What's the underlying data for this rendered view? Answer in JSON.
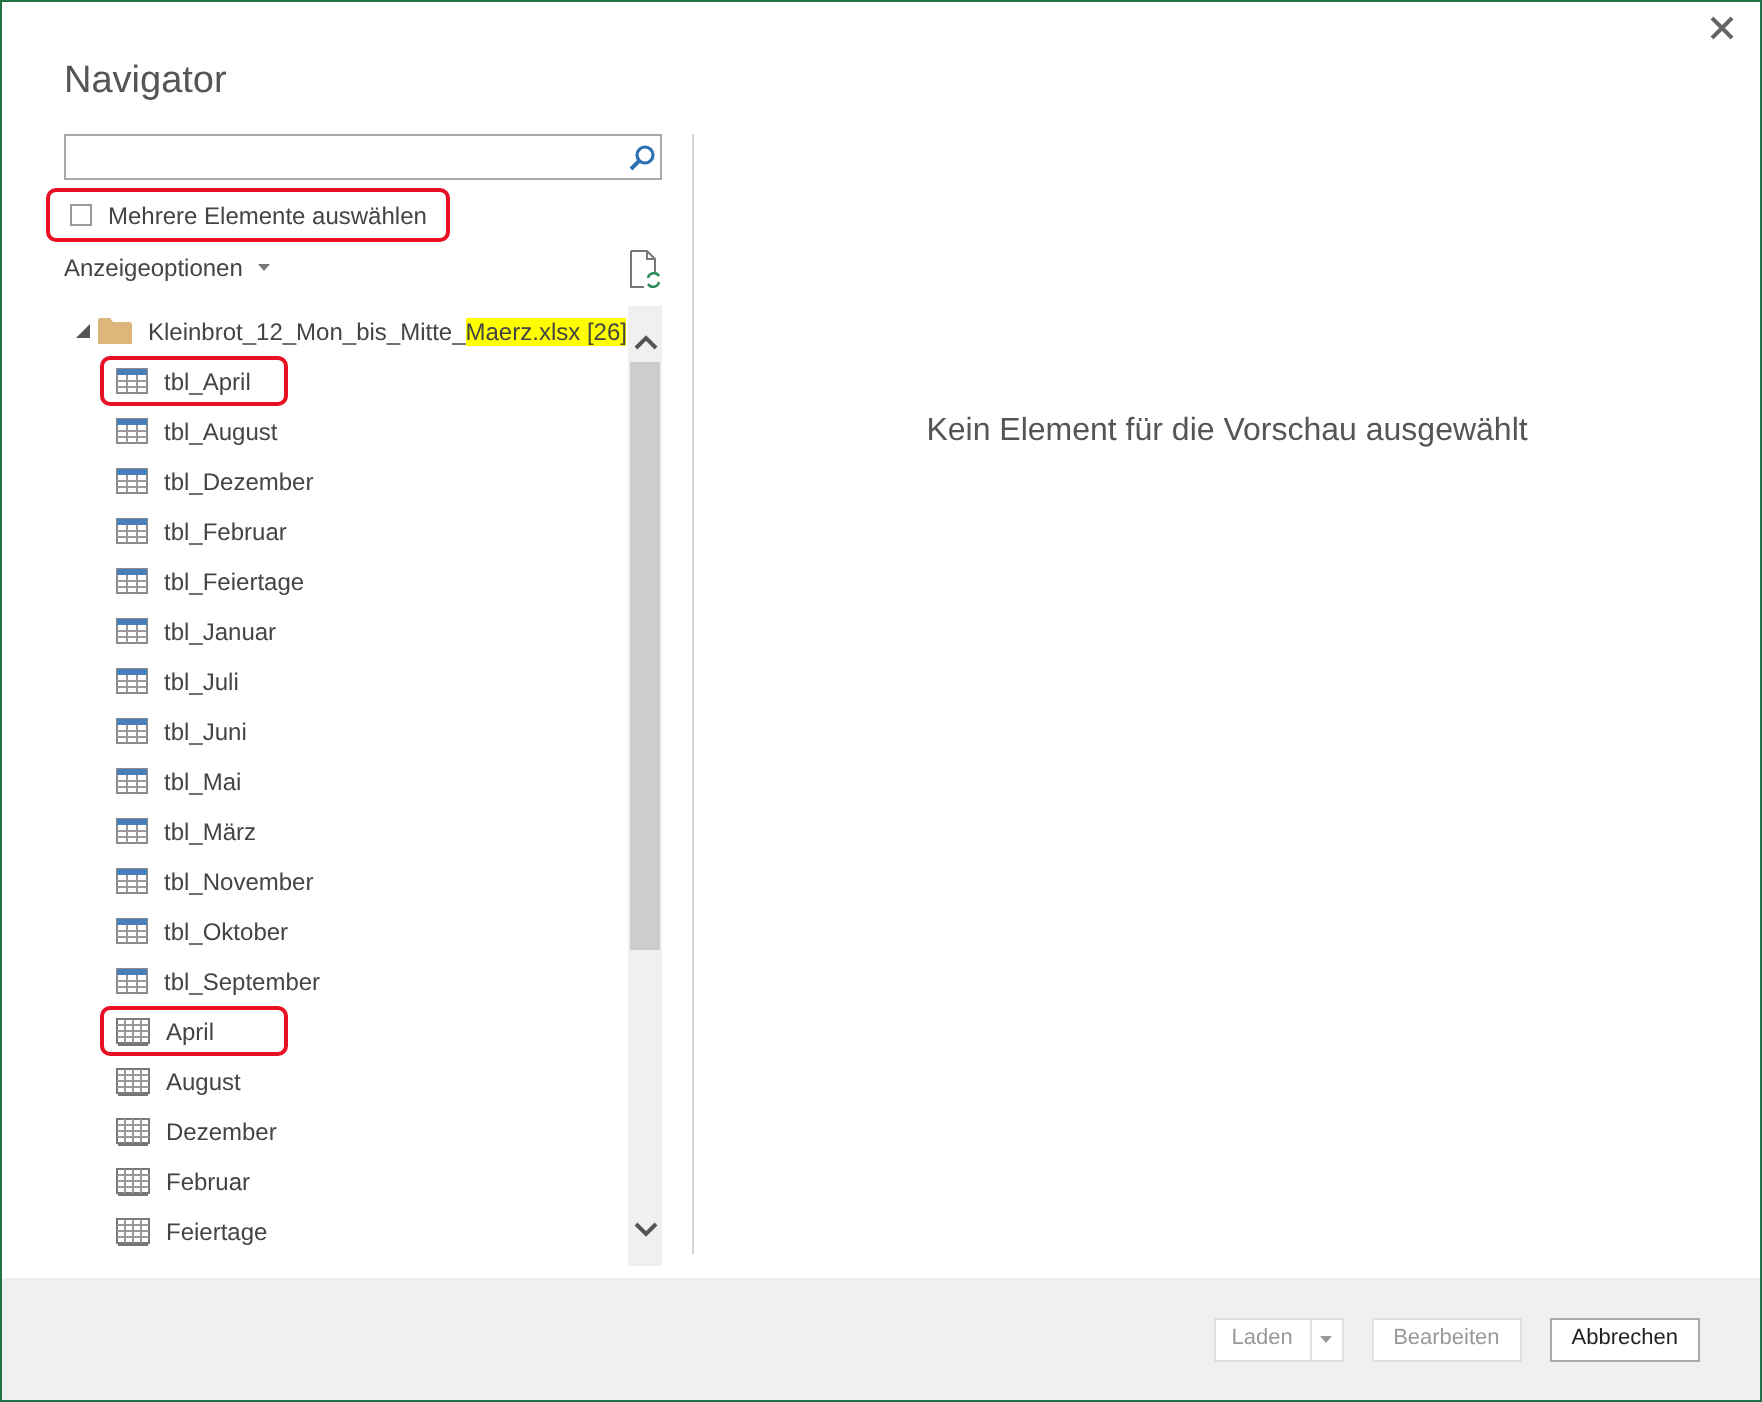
{
  "window": {
    "title": "Navigator"
  },
  "multi_select": {
    "label": "Mehrere Elemente auswählen",
    "checked": false,
    "annotated": true
  },
  "display_options": {
    "label": "Anzeigeoptionen"
  },
  "tree": [
    {
      "label": "Kleinbrot_12_Mon_bis_Mitte_",
      "highlight": "Maerz.xlsx [26]",
      "expanded": true,
      "children": [
        {
          "label": "tbl_April",
          "kind": "table",
          "annotated": true
        },
        {
          "label": "tbl_August",
          "kind": "table",
          "annotated": false
        },
        {
          "label": "tbl_Dezember",
          "kind": "table",
          "annotated": false
        },
        {
          "label": "tbl_Februar",
          "kind": "table",
          "annotated": false
        },
        {
          "label": "tbl_Feiertage",
          "kind": "table",
          "annotated": false
        },
        {
          "label": "tbl_Januar",
          "kind": "table",
          "annotated": false
        },
        {
          "label": "tbl_Juli",
          "kind": "table",
          "annotated": false
        },
        {
          "label": "tbl_Juni",
          "kind": "table",
          "annotated": false
        },
        {
          "label": "tbl_Mai",
          "kind": "table",
          "annotated": false
        },
        {
          "label": "tbl_März",
          "kind": "table",
          "annotated": false
        },
        {
          "label": "tbl_November",
          "kind": "table",
          "annotated": false
        },
        {
          "label": "tbl_Oktober",
          "kind": "table",
          "annotated": false
        },
        {
          "label": "tbl_September",
          "kind": "table",
          "annotated": false
        },
        {
          "label": "April",
          "kind": "sheet",
          "annotated": true
        },
        {
          "label": "August",
          "kind": "sheet",
          "annotated": false
        },
        {
          "label": "Dezember",
          "kind": "sheet",
          "annotated": false
        },
        {
          "label": "Februar",
          "kind": "sheet",
          "annotated": false
        },
        {
          "label": "Feiertage",
          "kind": "sheet",
          "annotated": false
        }
      ]
    }
  ],
  "preview": {
    "message": "Kein Element für die Vorschau ausgewählt"
  },
  "buttons": [
    {
      "label": "Laden",
      "disabled": true,
      "kind": "split"
    },
    {
      "label": "Bearbeiten",
      "disabled": true,
      "kind": "plain"
    },
    {
      "label": "Abbrechen",
      "disabled": false,
      "kind": "plain"
    }
  ]
}
